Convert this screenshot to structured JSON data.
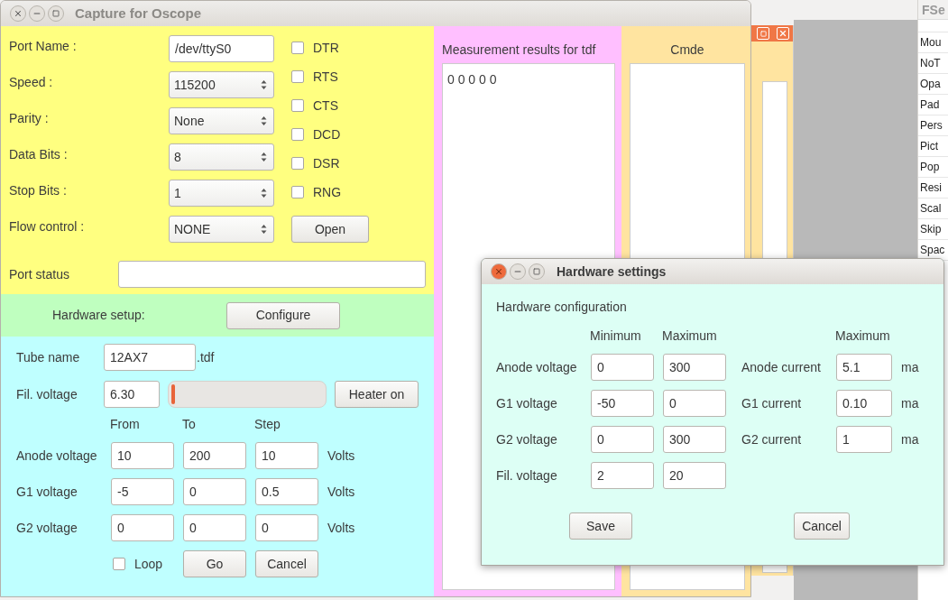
{
  "main_window": {
    "title": "Capture for Oscope"
  },
  "serial": {
    "fields": [
      {
        "label": "Port Name :",
        "value": "/dev/ttyS0",
        "kind": "text"
      },
      {
        "label": "Speed :",
        "value": "115200",
        "kind": "spin"
      },
      {
        "label": "Parity :",
        "value": "None",
        "kind": "spin"
      },
      {
        "label": "Data Bits :",
        "value": "8",
        "kind": "spin"
      },
      {
        "label": "Stop Bits :",
        "value": "1",
        "kind": "spin"
      },
      {
        "label": "Flow control :",
        "value": "NONE",
        "kind": "spin"
      }
    ],
    "signals": [
      {
        "label": "DTR",
        "checked": false
      },
      {
        "label": "RTS",
        "checked": false
      },
      {
        "label": "CTS",
        "checked": false
      },
      {
        "label": "DCD",
        "checked": false
      },
      {
        "label": "DSR",
        "checked": false
      },
      {
        "label": "RNG",
        "checked": false
      }
    ],
    "open_button": "Open",
    "status_label": "Port status"
  },
  "hardware_setup": {
    "label": "Hardware setup:",
    "button": "Configure"
  },
  "tube": {
    "name_label": "Tube name",
    "name_value": "12AX7",
    "suffix": ".tdf",
    "fil_label": "Fil. voltage",
    "fil_value": "6.30",
    "heater": {
      "level": 0.02
    },
    "heater_button": "Heater on",
    "columns": [
      "From",
      "To",
      "Step"
    ],
    "rows": [
      {
        "label": "Anode voltage",
        "values": [
          "10",
          "200",
          "10"
        ],
        "unit": "Volts"
      },
      {
        "label": "G1 voltage",
        "values": [
          "-5",
          "0",
          "0.5"
        ],
        "unit": "Volts"
      },
      {
        "label": "G2 voltage",
        "values": [
          "0",
          "0",
          "0"
        ],
        "unit": "Volts"
      }
    ],
    "loop": {
      "label": "Loop",
      "checked": false
    },
    "go_button": "Go",
    "cancel_button": "Cancel"
  },
  "results": {
    "title": "Measurement results for tdf",
    "text": "0 0 0 0 0"
  },
  "command": {
    "title": "Cmde"
  },
  "background_list": {
    "header": "FSe",
    "items": [
      "Mou",
      "NoT",
      "Opa",
      "Pad",
      "Pers",
      "Pict",
      "Pop",
      "Resi",
      "Scal",
      "Skip",
      "Spac"
    ]
  },
  "dialog": {
    "title": "Hardware settings",
    "heading": "Hardware configuration",
    "columns": [
      "Minimum",
      "Maximum"
    ],
    "right_column": "Maximum",
    "rows": [
      {
        "label": "Anode voltage",
        "min": "0",
        "max": "300",
        "current_label": "Anode current",
        "current_max": "5.1",
        "unit": "ma"
      },
      {
        "label": "G1 voltage",
        "min": "-50",
        "max": "0",
        "current_label": "G1 current",
        "current_max": "0.10",
        "unit": "ma"
      },
      {
        "label": "G2 voltage",
        "min": "0",
        "max": "300",
        "current_label": "G2 current",
        "current_max": "1",
        "unit": "ma"
      },
      {
        "label": "Fil. voltage",
        "min": "2",
        "max": "20"
      }
    ],
    "save_button": "Save",
    "cancel_button": "Cancel"
  }
}
